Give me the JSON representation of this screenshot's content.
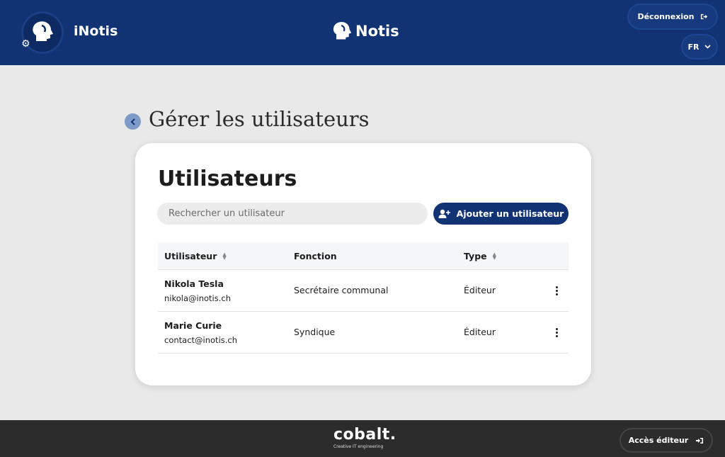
{
  "header": {
    "app_name": "iNotis",
    "brand_name": "Notis",
    "logout_label": "Déconnexion",
    "language": "FR"
  },
  "page": {
    "title": "Gérer les utilisateurs"
  },
  "card": {
    "title": "Utilisateurs",
    "search_placeholder": "Rechercher un utilisateur",
    "add_button_label": "Ajouter un utilisateur"
  },
  "table": {
    "headers": {
      "user": "Utilisateur",
      "function": "Fonction",
      "type": "Type"
    },
    "rows": [
      {
        "name": "Nikola Tesla",
        "email": "nikola@inotis.ch",
        "function": "Secrétaire communal",
        "type": "Éditeur"
      },
      {
        "name": "Marie Curie",
        "email": "contact@inotis.ch",
        "function": "Syndique",
        "type": "Éditeur"
      }
    ]
  },
  "footer": {
    "logo_name": "cobalt.",
    "logo_tagline": "Creative IT engineering",
    "editor_access_label": "Accès éditeur"
  },
  "colors": {
    "primary": "#123373",
    "background": "#e9e9ea",
    "footer": "#2c2c2c"
  }
}
